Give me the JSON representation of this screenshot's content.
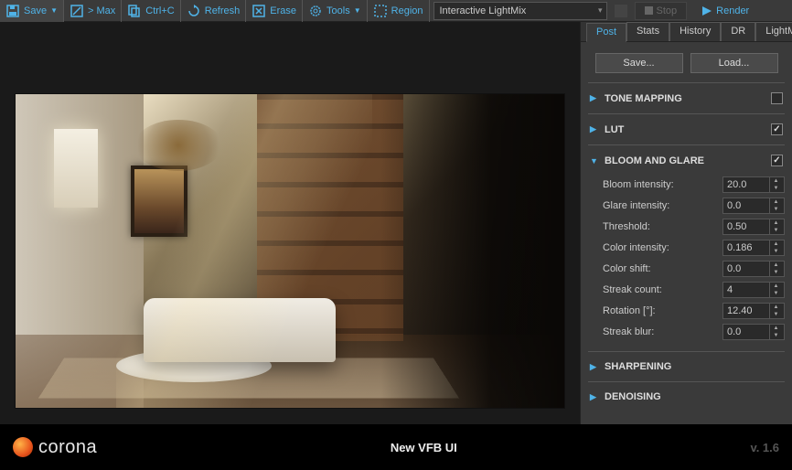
{
  "toolbar": {
    "save": "Save",
    "max": "> Max",
    "copy": "Ctrl+C",
    "refresh": "Refresh",
    "erase": "Erase",
    "tools": "Tools",
    "region": "Region",
    "dropdown": "Interactive LightMix",
    "stop": "Stop",
    "render": "Render"
  },
  "tabs": [
    "Post",
    "Stats",
    "History",
    "DR",
    "LightMix"
  ],
  "activeTab": "Post",
  "buttons": {
    "save": "Save...",
    "load": "Load..."
  },
  "sections": {
    "tone": {
      "title": "TONE MAPPING",
      "open": false,
      "checked": false
    },
    "lut": {
      "title": "LUT",
      "open": false,
      "checked": true
    },
    "bloom": {
      "title": "BLOOM AND GLARE",
      "open": true,
      "checked": true
    },
    "sharpen": {
      "title": "SHARPENING",
      "open": false
    },
    "denoise": {
      "title": "DENOISING",
      "open": false
    }
  },
  "bloom": {
    "props": [
      {
        "label": "Bloom intensity:",
        "value": "20.0"
      },
      {
        "label": "Glare intensity:",
        "value": "0.0"
      },
      {
        "label": "Threshold:",
        "value": "0.50"
      },
      {
        "label": "Color intensity:",
        "value": "0.186"
      },
      {
        "label": "Color shift:",
        "value": "0.0"
      },
      {
        "label": "Streak count:",
        "value": "4"
      },
      {
        "label": "Rotation [°]:",
        "value": "12.40"
      },
      {
        "label": "Streak blur:",
        "value": "0.0"
      }
    ]
  },
  "footer": {
    "brand": "corona",
    "title": "New VFB UI",
    "version": "v. 1.6"
  }
}
